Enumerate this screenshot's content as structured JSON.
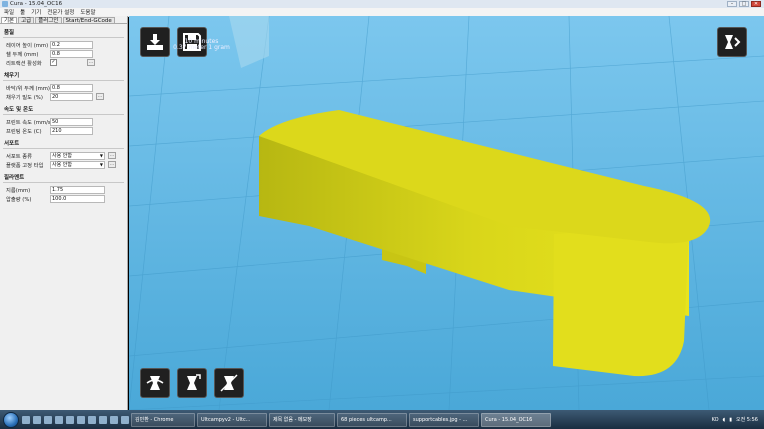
{
  "window": {
    "title": "Cura - 15.04_OC16",
    "controls": [
      "–",
      "□",
      "✕"
    ]
  },
  "menu": [
    "파일",
    "툴",
    "기기",
    "전문가 설정",
    "도움말"
  ],
  "tabs": [
    "기본",
    "고급",
    "플러그인",
    "Start/End-GCode"
  ],
  "sections": {
    "quality": {
      "title": "품질",
      "layer_height_label": "레이어 높이 (mm)",
      "layer_height": "0.2",
      "shell_label": "쉘 두께 (mm)",
      "shell": "0.8",
      "retraction_label": "리트랙션 활성화",
      "retraction_checked": "✓"
    },
    "fill": {
      "title": "채우기",
      "bottom_top_label": "바닥/위 두께 (mm)",
      "bottom_top": "0.8",
      "density_label": "채우기 밀도 (%)",
      "density": "20"
    },
    "speed": {
      "title": "속도 및 온도",
      "print_speed_label": "프린트 속도 (mm/s)",
      "print_speed": "50",
      "temp_label": "프린팅 온도 (C)",
      "temp": "210"
    },
    "support": {
      "title": "서포트",
      "type_label": "서포트 종류",
      "type_value": "사용 안함",
      "adhesion_label": "플랫폼 고정 타입",
      "adhesion_value": "사용 안함"
    },
    "filament": {
      "title": "필라멘트",
      "diameter_label": "지름(mm)",
      "diameter": "1.75",
      "flow_label": "압출량 (%)",
      "flow": "100.0"
    }
  },
  "print_info": {
    "line1": "10 minutes",
    "line2": "0.37 meter 1 gram"
  },
  "colors": {
    "bed": "#5bb3df",
    "model": "#e6e21c",
    "panel": "#f0f0f0"
  },
  "icons": {
    "load": "load-model-icon",
    "save": "save-icon",
    "view_mode": "view-mode-icon",
    "rotate": "rotate-icon",
    "scale": "scale-icon",
    "mirror": "mirror-icon"
  },
  "taskbar": {
    "tasks": [
      "김민환 - Chrome",
      "Ultcampyv2 - Ultc...",
      "제목 없음 - 메모장",
      "68 pieces ultcamp...",
      "supportcables.jpg - ...",
      "Cura - 15.04_OC16"
    ],
    "tray": {
      "lang": "KO",
      "time": "오전 5:56"
    }
  }
}
